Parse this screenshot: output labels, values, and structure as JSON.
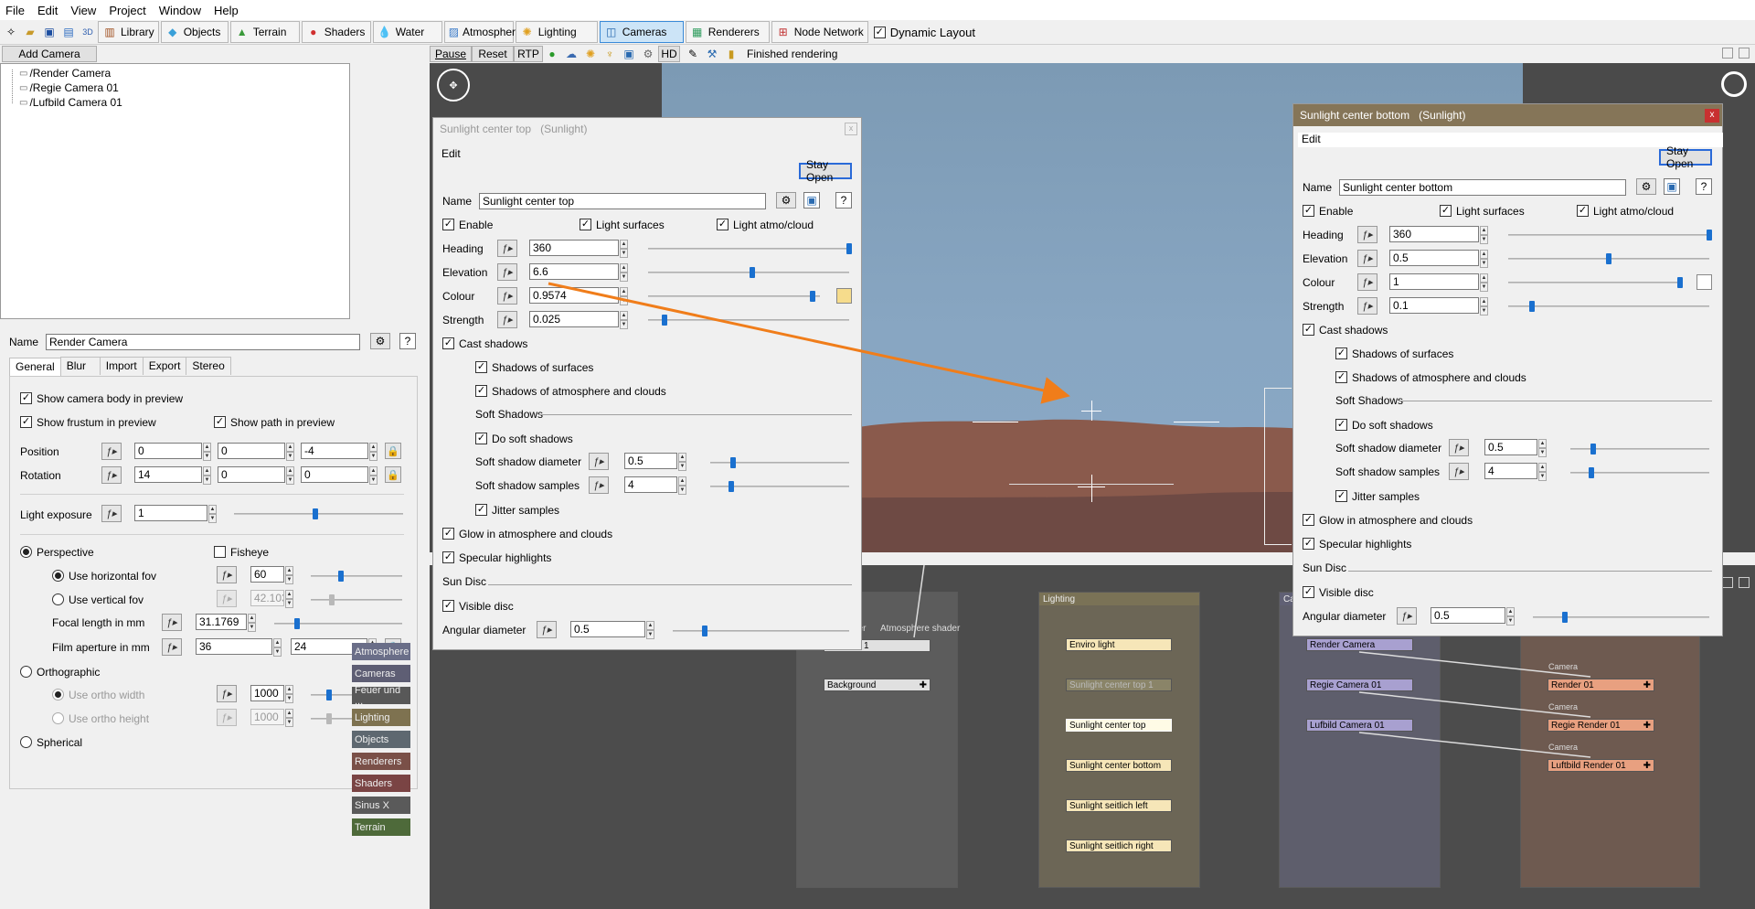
{
  "menu": [
    "File",
    "Edit",
    "View",
    "Project",
    "Window",
    "Help"
  ],
  "toolbar": {
    "tabs": [
      {
        "label": "Library",
        "icon": "library-icon"
      },
      {
        "label": "Objects",
        "icon": "cube-icon"
      },
      {
        "label": "Terrain",
        "icon": "terrain-icon"
      },
      {
        "label": "Shaders",
        "icon": "shader-sphere-icon"
      },
      {
        "label": "Water",
        "icon": "water-drop-icon"
      },
      {
        "label": "Atmosphere",
        "icon": "atmosphere-icon"
      },
      {
        "label": "Lighting",
        "icon": "sun-icon"
      },
      {
        "label": "Cameras",
        "icon": "camera-icon"
      },
      {
        "label": "Renderers",
        "icon": "renderer-icon"
      },
      {
        "label": "Node Network",
        "icon": "node-network-icon"
      }
    ],
    "active_tab": "Cameras",
    "dynamic_layout": "Dynamic Layout"
  },
  "left": {
    "add_camera": "Add Camera",
    "cameras": [
      "/Render Camera",
      "/Regie Camera 01",
      "/Lufbild Camera 01"
    ],
    "name_label": "Name",
    "name_value": "Render Camera",
    "tabs": [
      "General",
      "Blur",
      "Import",
      "Export",
      "Stereo"
    ],
    "active_tab": "General",
    "show_body": "Show camera body in preview",
    "show_frustum": "Show frustum in preview",
    "show_path": "Show path in preview",
    "position_label": "Position",
    "position": [
      "0",
      "0",
      "-4"
    ],
    "rotation_label": "Rotation",
    "rotation": [
      "14",
      "0",
      "0"
    ],
    "light_exposure_label": "Light exposure",
    "light_exposure": "1",
    "light_exposure_level": 0.48,
    "perspective": "Perspective",
    "fisheye": "Fisheye",
    "use_hfov": "Use horizontal fov",
    "hfov": "60",
    "use_vfov": "Use vertical fov",
    "vfov": "42.103",
    "focal_label": "Focal length in mm",
    "focal": "31.1769",
    "aperture_label": "Film aperture in mm",
    "aperture": [
      "36",
      "24"
    ],
    "orthographic": "Orthographic",
    "ortho_width_label": "Use ortho width",
    "ortho_width": "1000",
    "ortho_height_label": "Use ortho height",
    "ortho_height": "1000",
    "spherical": "Spherical"
  },
  "render_bar": {
    "pause": "Pause",
    "reset": "Reset",
    "rtp": "RTP",
    "hd": "HD",
    "status": "Finished rendering"
  },
  "dialog_top": {
    "title": "Sunlight center top",
    "type": "(Sunlight)",
    "edit": "Edit",
    "stay_open": "Stay Open",
    "name_label": "Name",
    "name_value": "Sunlight center top",
    "enable": "Enable",
    "light_surfaces": "Light surfaces",
    "light_atmo": "Light atmo/cloud",
    "heading_label": "Heading",
    "heading": "360",
    "heading_level": 1.0,
    "elevation_label": "Elevation",
    "elevation": "6.6",
    "elevation_level": 0.52,
    "colour_label": "Colour",
    "colour": "0.9574",
    "colour_level": 0.96,
    "colour_swatch": "#f6dc8c",
    "strength_label": "Strength",
    "strength": "0.025",
    "strength_level": 0.08,
    "cast_shadows": "Cast shadows",
    "shadows_surfaces": "Shadows of surfaces",
    "shadows_atmo": "Shadows of atmosphere and clouds",
    "soft_shadows_header": "Soft Shadows",
    "do_soft": "Do soft shadows",
    "soft_diam_label": "Soft shadow diameter",
    "soft_diam": "0.5",
    "soft_samples_label": "Soft shadow samples",
    "soft_samples": "4",
    "jitter": "Jitter samples",
    "glow": "Glow in atmosphere and clouds",
    "specular": "Specular highlights",
    "sun_disc_header": "Sun Disc",
    "visible_disc": "Visible disc",
    "angular_label": "Angular diameter",
    "angular": "0.5"
  },
  "dialog_bottom": {
    "title": "Sunlight center bottom",
    "type": "(Sunlight)",
    "close": "x",
    "edit": "Edit",
    "stay_open": "Stay Open",
    "name_label": "Name",
    "name_value": "Sunlight center bottom",
    "enable": "Enable",
    "light_surfaces": "Light surfaces",
    "light_atmo": "Light atmo/cloud",
    "heading_label": "Heading",
    "heading": "360",
    "heading_level": 1.0,
    "elevation_label": "Elevation",
    "elevation": "0.5",
    "elevation_level": 0.5,
    "colour_label": "Colour",
    "colour": "1",
    "colour_level": 1.0,
    "colour_swatch": "#ffffff",
    "strength_label": "Strength",
    "strength": "0.1",
    "strength_level": 0.12,
    "cast_shadows": "Cast shadows",
    "shadows_surfaces": "Shadows of surfaces",
    "shadows_atmo": "Shadows of atmosphere and clouds",
    "soft_shadows_header": "Soft Shadows",
    "do_soft": "Do soft shadows",
    "soft_diam_label": "Soft shadow diameter",
    "soft_diam": "0.5",
    "soft_samples_label": "Soft shadow samples",
    "soft_samples": "4",
    "jitter": "Jitter samples",
    "glow": "Glow in atmosphere and clouds",
    "specular": "Specular highlights",
    "sun_disc_header": "Sun Disc",
    "visible_disc": "Visible disc",
    "angular_label": "Angular diameter",
    "angular": "0.5"
  },
  "node_sidebar": [
    "Atmosphere",
    "Cameras",
    "Feuer und ...",
    "Lighting",
    "Objects",
    "Renderers",
    "Shaders",
    "Sinus X",
    "Terrain"
  ],
  "node_network": {
    "atmo_labels": [
      "der",
      "Atmosphere shader"
    ],
    "atmo_node_partial": "1",
    "background": "Background",
    "lighting_header": "Lighting",
    "lights": [
      "Enviro light",
      "Sunlight center top 1",
      "Sunlight center top",
      "Sunlight center bottom",
      "Sunlight seitlich left",
      "Sunlight seitlich right"
    ],
    "cameras_header": "Ca",
    "cameras": [
      "Render Camera",
      "Regie Camera 01",
      "Lufbild Camera 01"
    ],
    "camera_port": "Camera",
    "renders": [
      "Render 01",
      "Regie Render 01",
      "Luftbild Render 01"
    ]
  }
}
